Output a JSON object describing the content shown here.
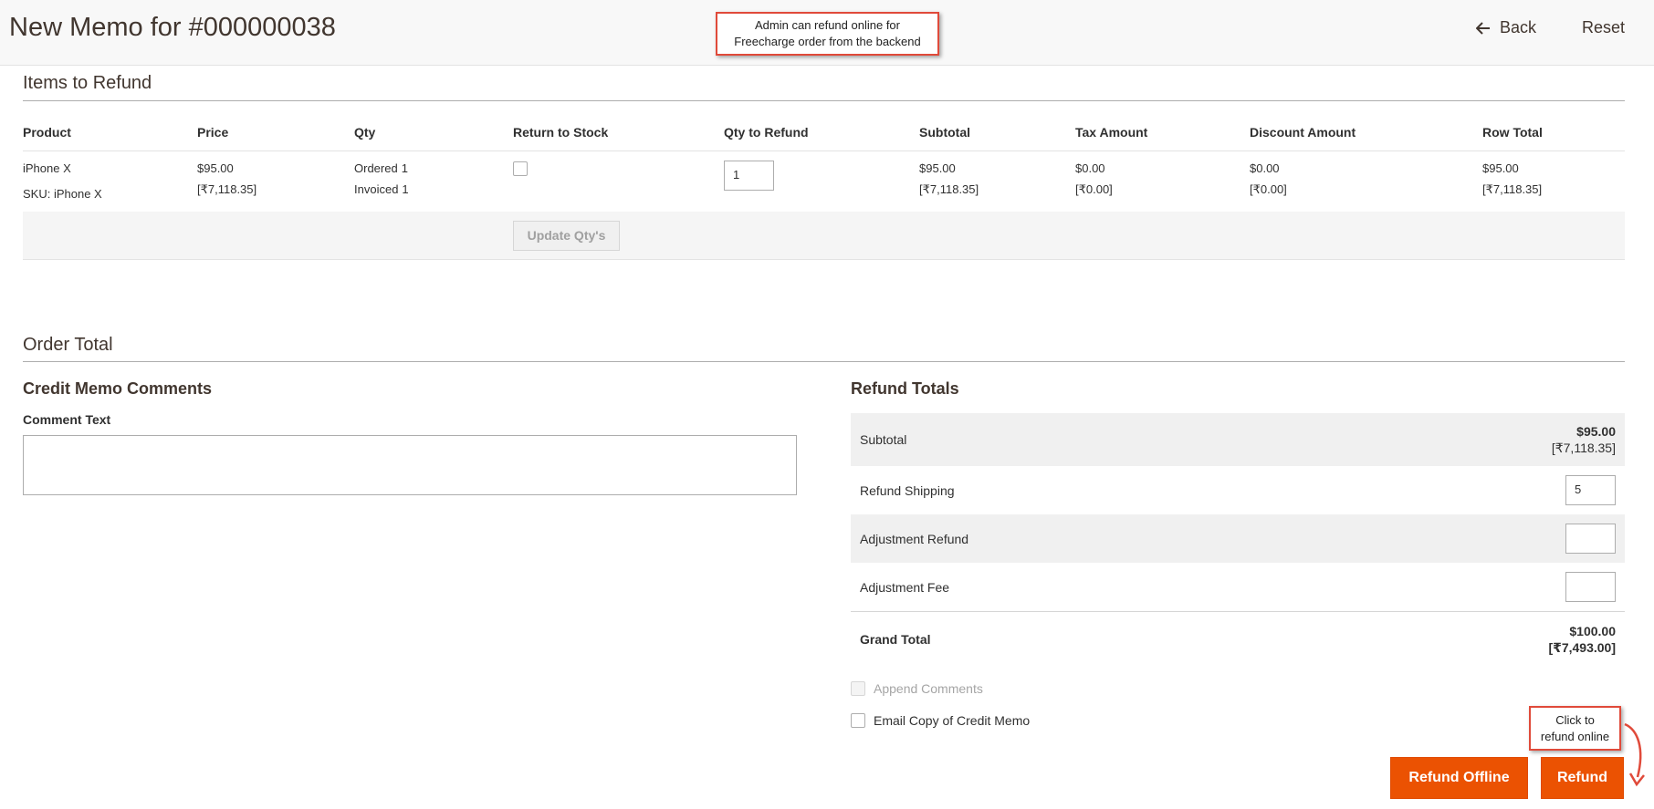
{
  "header": {
    "title": "New Memo for #000000038",
    "back_label": "Back",
    "reset_label": "Reset"
  },
  "callouts": {
    "top_line1": "Admin can refund online for",
    "top_line2": "Freecharge order from the backend",
    "bottom_line1": "Click to",
    "bottom_line2": "refund online"
  },
  "items": {
    "section_title": "Items to Refund",
    "columns": [
      "Product",
      "Price",
      "Qty",
      "Return to Stock",
      "Qty to Refund",
      "Subtotal",
      "Tax Amount",
      "Discount Amount",
      "Row Total"
    ],
    "row": {
      "product_name": "iPhone X",
      "sku": "SKU: iPhone X",
      "price": "$95.00",
      "price_base": "[₹7,118.35]",
      "ordered_label": "Ordered",
      "ordered_qty": "1",
      "invoiced_label": "Invoiced",
      "invoiced_qty": "1",
      "qty_to_refund": "1",
      "subtotal": "$95.00",
      "subtotal_base": "[₹7,118.35]",
      "tax": "$0.00",
      "tax_base": "[₹0.00]",
      "discount": "$0.00",
      "discount_base": "[₹0.00]",
      "row_total": "$95.00",
      "row_total_base": "[₹7,118.35]"
    },
    "update_button": "Update Qty's"
  },
  "order_total": {
    "section_title": "Order Total",
    "comments_title": "Credit Memo Comments",
    "comment_label": "Comment Text",
    "comment_value": "",
    "refund_totals_title": "Refund Totals",
    "subtotal_label": "Subtotal",
    "subtotal_value": "$95.00",
    "subtotal_base": "[₹7,118.35]",
    "refund_shipping_label": "Refund Shipping",
    "refund_shipping_value": "5",
    "adjustment_refund_label": "Adjustment Refund",
    "adjustment_refund_value": "",
    "adjustment_fee_label": "Adjustment Fee",
    "adjustment_fee_value": "",
    "grand_total_label": "Grand Total",
    "grand_total_value": "$100.00",
    "grand_total_base": "[₹7,493.00]",
    "append_comments_label": "Append Comments",
    "email_copy_label": "Email Copy of Credit Memo",
    "refund_offline_button": "Refund Offline",
    "refund_button": "Refund"
  },
  "colors": {
    "accent": "#eb5202",
    "callout_border": "#e04a3a"
  }
}
